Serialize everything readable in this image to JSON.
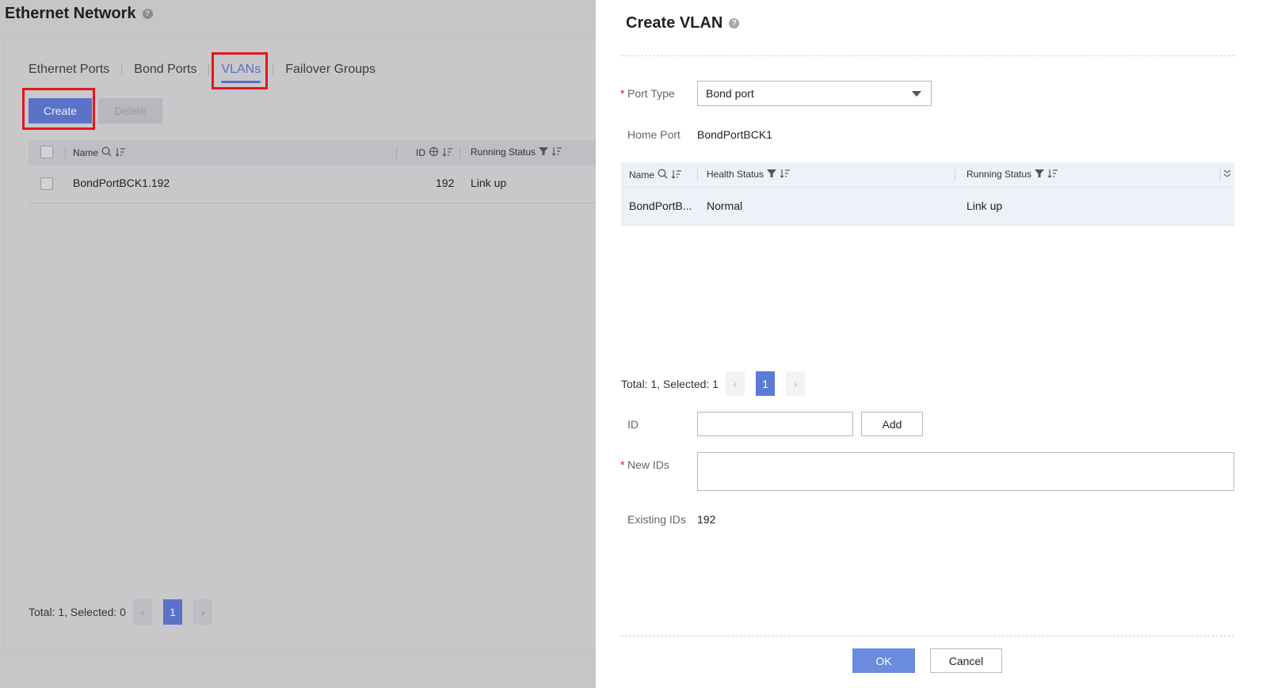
{
  "page": {
    "title": "Ethernet Network",
    "tabs": [
      "Ethernet Ports",
      "Bond Ports",
      "VLANs",
      "Failover Groups"
    ],
    "active_tab": "VLANs",
    "toolbar": {
      "create_label": "Create",
      "delete_label": "Delete"
    },
    "table": {
      "headers": {
        "name": "Name",
        "id": "ID",
        "running_status": "Running Status"
      },
      "rows": [
        {
          "name": "BondPortBCK1.192",
          "id": "192",
          "running_status": "Link up"
        }
      ]
    },
    "pager": {
      "summary": "Total: 1, Selected: 0",
      "page": "1"
    }
  },
  "drawer": {
    "title": "Create VLAN",
    "port_type": {
      "label": "Port Type",
      "value": "Bond port"
    },
    "home_port": {
      "label": "Home Port",
      "value": "BondPortBCK1"
    },
    "table": {
      "headers": {
        "name": "Name",
        "health_status": "Health Status",
        "running_status": "Running Status"
      },
      "rows": [
        {
          "name": "BondPortB...",
          "health_status": "Normal",
          "running_status": "Link up"
        }
      ]
    },
    "pager": {
      "summary": "Total: 1, Selected: 1",
      "page": "1"
    },
    "id_field": {
      "label": "ID",
      "value": "",
      "add_label": "Add"
    },
    "new_ids": {
      "label": "New IDs",
      "value": ""
    },
    "existing_ids": {
      "label": "Existing IDs",
      "value": "192"
    },
    "footer": {
      "ok_label": "OK",
      "cancel_label": "Cancel"
    }
  },
  "colors": {
    "accent": "#5b7bd5",
    "highlight_box": "#e3161c",
    "required": "#e3161c"
  },
  "icons": [
    "help-icon",
    "search-icon",
    "sort-icon",
    "filter-icon",
    "caret-down-icon",
    "chevron-left-icon",
    "chevron-right-icon",
    "expand-icon"
  ]
}
